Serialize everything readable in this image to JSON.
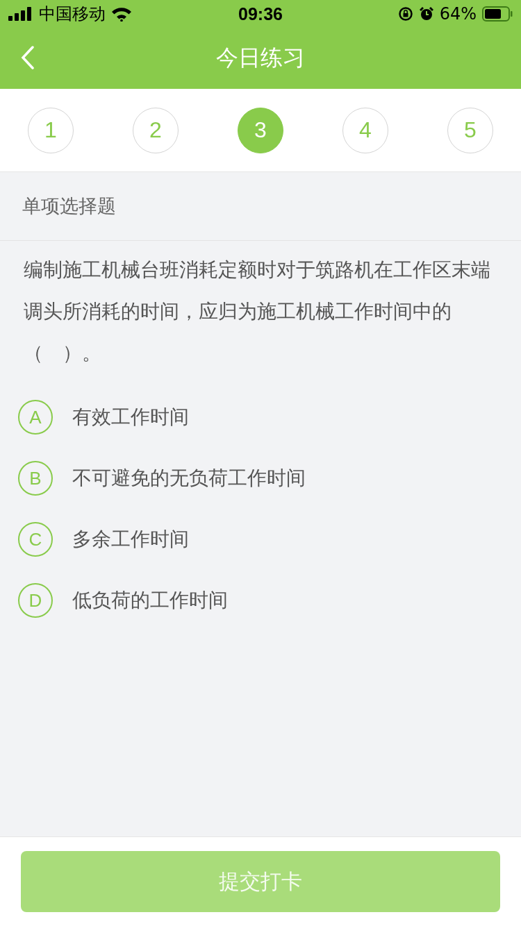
{
  "status_bar": {
    "carrier": "中国移动",
    "time": "09:36",
    "battery": "64%"
  },
  "header": {
    "title": "今日练习"
  },
  "steps": [
    {
      "label": "1",
      "selected": false
    },
    {
      "label": "2",
      "selected": false
    },
    {
      "label": "3",
      "selected": true
    },
    {
      "label": "4",
      "selected": false
    },
    {
      "label": "5",
      "selected": false
    }
  ],
  "question_type": "单项选择题",
  "question": "编制施工机械台班消耗定额时对于筑路机在工作区末端调头所消耗的时间，应归为施工机械工作时间中的（　）。",
  "options": [
    {
      "letter": "A",
      "text": "有效工作时间",
      "selected": false
    },
    {
      "letter": "B",
      "text": "不可避免的无负荷工作时间",
      "selected": false
    },
    {
      "letter": "C",
      "text": "多余工作时间",
      "selected": false
    },
    {
      "letter": "D",
      "text": "低负荷的工作时间",
      "selected": false
    }
  ],
  "submit": {
    "label": "提交打卡",
    "disabled": true
  }
}
